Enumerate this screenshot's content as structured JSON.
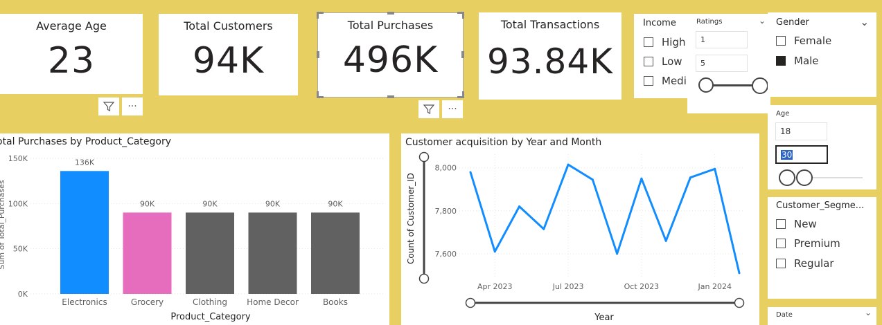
{
  "kpis": [
    {
      "title": "Average Age",
      "value": "23"
    },
    {
      "title": "Total Customers",
      "value": "94K"
    },
    {
      "title": "Total Purchases",
      "value": "496K"
    },
    {
      "title": "Total Transactions",
      "value": "93.84K"
    }
  ],
  "toolbar": {
    "filter_icon": "filter-icon",
    "more_label": "···"
  },
  "income_slicer": {
    "title": "Income",
    "options": [
      {
        "label": "High",
        "checked": false
      },
      {
        "label": "Low",
        "checked": false
      },
      {
        "label": "Mediu",
        "checked": false
      }
    ]
  },
  "ratings_slicer": {
    "title": "Ratings",
    "min": "1",
    "max": "5"
  },
  "gender_slicer": {
    "title": "Gender",
    "options": [
      {
        "label": "Female",
        "checked": false
      },
      {
        "label": "Male",
        "checked": true
      }
    ]
  },
  "age_slicer": {
    "title": "Age",
    "min": "18",
    "max": "30"
  },
  "segment_slicer": {
    "title": "Customer_Segme...",
    "options": [
      {
        "label": "New",
        "checked": false
      },
      {
        "label": "Premium",
        "checked": false
      },
      {
        "label": "Regular",
        "checked": false
      }
    ]
  },
  "date_slicer": {
    "title": "Date"
  },
  "colors": {
    "accent_blue": "#118dff",
    "pink": "#e66cbd",
    "gray": "#616161",
    "background": "#e8cf62"
  },
  "chart_data": [
    {
      "type": "bar",
      "title": "Total Purchases by Product_Category",
      "title_visible": "otal Purchases by Product_Category",
      "xlabel": "Product_Category",
      "ylabel": "Sum of Total_Purchases",
      "ylabel_visible": "Sum of Total_Purchases",
      "categories": [
        "Electronics",
        "Grocery",
        "Clothing",
        "Home Decor",
        "Books"
      ],
      "values": [
        136000,
        90000,
        90000,
        90000,
        90000
      ],
      "data_labels": [
        "136K",
        "90K",
        "90K",
        "90K",
        "90K"
      ],
      "bar_colors": [
        "#118dff",
        "#e66cbd",
        "#616161",
        "#616161",
        "#616161"
      ],
      "ylim": [
        0,
        150000
      ],
      "yticks": [
        {
          "v": 0,
          "label": "0K"
        },
        {
          "v": 50000,
          "label": "50K"
        },
        {
          "v": 100000,
          "label": "100K"
        },
        {
          "v": 150000,
          "label": "150K"
        }
      ],
      "grid": true
    },
    {
      "type": "line",
      "title": "Customer acquisition by Year and Month",
      "xlabel": "Year",
      "ylabel": "Count of Customer_ID",
      "x": [
        "2023-03",
        "2023-04",
        "2023-05",
        "2023-06",
        "2023-07",
        "2023-08",
        "2023-09",
        "2023-10",
        "2023-11",
        "2023-12",
        "2024-01",
        "2024-02"
      ],
      "values": [
        7980,
        7610,
        7820,
        7715,
        8015,
        7945,
        7600,
        7950,
        7660,
        7955,
        7995,
        7510
      ],
      "ylim": [
        7500,
        8070
      ],
      "yticks": [
        {
          "v": 7600,
          "label": "7,600"
        },
        {
          "v": 7800,
          "label": "7,800"
        },
        {
          "v": 8000,
          "label": "8,000"
        }
      ],
      "xticks": [
        {
          "i": 1,
          "label": "Apr 2023"
        },
        {
          "i": 4,
          "label": "Jul 2023"
        },
        {
          "i": 7,
          "label": "Oct 2023"
        },
        {
          "i": 10,
          "label": "Jan 2024"
        }
      ],
      "line_color": "#118dff",
      "grid": true
    }
  ]
}
